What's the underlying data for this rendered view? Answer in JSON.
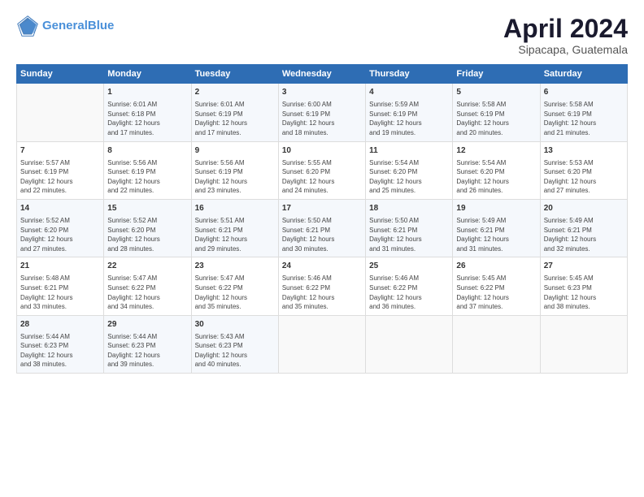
{
  "header": {
    "logo_line1": "General",
    "logo_line2": "Blue",
    "main_title": "April 2024",
    "subtitle": "Sipacapa, Guatemala"
  },
  "days_of_week": [
    "Sunday",
    "Monday",
    "Tuesday",
    "Wednesday",
    "Thursday",
    "Friday",
    "Saturday"
  ],
  "weeks": [
    [
      {
        "day": "",
        "info": ""
      },
      {
        "day": "1",
        "info": "Sunrise: 6:01 AM\nSunset: 6:18 PM\nDaylight: 12 hours\nand 17 minutes."
      },
      {
        "day": "2",
        "info": "Sunrise: 6:01 AM\nSunset: 6:19 PM\nDaylight: 12 hours\nand 17 minutes."
      },
      {
        "day": "3",
        "info": "Sunrise: 6:00 AM\nSunset: 6:19 PM\nDaylight: 12 hours\nand 18 minutes."
      },
      {
        "day": "4",
        "info": "Sunrise: 5:59 AM\nSunset: 6:19 PM\nDaylight: 12 hours\nand 19 minutes."
      },
      {
        "day": "5",
        "info": "Sunrise: 5:58 AM\nSunset: 6:19 PM\nDaylight: 12 hours\nand 20 minutes."
      },
      {
        "day": "6",
        "info": "Sunrise: 5:58 AM\nSunset: 6:19 PM\nDaylight: 12 hours\nand 21 minutes."
      }
    ],
    [
      {
        "day": "7",
        "info": "Sunrise: 5:57 AM\nSunset: 6:19 PM\nDaylight: 12 hours\nand 22 minutes."
      },
      {
        "day": "8",
        "info": "Sunrise: 5:56 AM\nSunset: 6:19 PM\nDaylight: 12 hours\nand 22 minutes."
      },
      {
        "day": "9",
        "info": "Sunrise: 5:56 AM\nSunset: 6:19 PM\nDaylight: 12 hours\nand 23 minutes."
      },
      {
        "day": "10",
        "info": "Sunrise: 5:55 AM\nSunset: 6:20 PM\nDaylight: 12 hours\nand 24 minutes."
      },
      {
        "day": "11",
        "info": "Sunrise: 5:54 AM\nSunset: 6:20 PM\nDaylight: 12 hours\nand 25 minutes."
      },
      {
        "day": "12",
        "info": "Sunrise: 5:54 AM\nSunset: 6:20 PM\nDaylight: 12 hours\nand 26 minutes."
      },
      {
        "day": "13",
        "info": "Sunrise: 5:53 AM\nSunset: 6:20 PM\nDaylight: 12 hours\nand 27 minutes."
      }
    ],
    [
      {
        "day": "14",
        "info": "Sunrise: 5:52 AM\nSunset: 6:20 PM\nDaylight: 12 hours\nand 27 minutes."
      },
      {
        "day": "15",
        "info": "Sunrise: 5:52 AM\nSunset: 6:20 PM\nDaylight: 12 hours\nand 28 minutes."
      },
      {
        "day": "16",
        "info": "Sunrise: 5:51 AM\nSunset: 6:21 PM\nDaylight: 12 hours\nand 29 minutes."
      },
      {
        "day": "17",
        "info": "Sunrise: 5:50 AM\nSunset: 6:21 PM\nDaylight: 12 hours\nand 30 minutes."
      },
      {
        "day": "18",
        "info": "Sunrise: 5:50 AM\nSunset: 6:21 PM\nDaylight: 12 hours\nand 31 minutes."
      },
      {
        "day": "19",
        "info": "Sunrise: 5:49 AM\nSunset: 6:21 PM\nDaylight: 12 hours\nand 31 minutes."
      },
      {
        "day": "20",
        "info": "Sunrise: 5:49 AM\nSunset: 6:21 PM\nDaylight: 12 hours\nand 32 minutes."
      }
    ],
    [
      {
        "day": "21",
        "info": "Sunrise: 5:48 AM\nSunset: 6:21 PM\nDaylight: 12 hours\nand 33 minutes."
      },
      {
        "day": "22",
        "info": "Sunrise: 5:47 AM\nSunset: 6:22 PM\nDaylight: 12 hours\nand 34 minutes."
      },
      {
        "day": "23",
        "info": "Sunrise: 5:47 AM\nSunset: 6:22 PM\nDaylight: 12 hours\nand 35 minutes."
      },
      {
        "day": "24",
        "info": "Sunrise: 5:46 AM\nSunset: 6:22 PM\nDaylight: 12 hours\nand 35 minutes."
      },
      {
        "day": "25",
        "info": "Sunrise: 5:46 AM\nSunset: 6:22 PM\nDaylight: 12 hours\nand 36 minutes."
      },
      {
        "day": "26",
        "info": "Sunrise: 5:45 AM\nSunset: 6:22 PM\nDaylight: 12 hours\nand 37 minutes."
      },
      {
        "day": "27",
        "info": "Sunrise: 5:45 AM\nSunset: 6:23 PM\nDaylight: 12 hours\nand 38 minutes."
      }
    ],
    [
      {
        "day": "28",
        "info": "Sunrise: 5:44 AM\nSunset: 6:23 PM\nDaylight: 12 hours\nand 38 minutes."
      },
      {
        "day": "29",
        "info": "Sunrise: 5:44 AM\nSunset: 6:23 PM\nDaylight: 12 hours\nand 39 minutes."
      },
      {
        "day": "30",
        "info": "Sunrise: 5:43 AM\nSunset: 6:23 PM\nDaylight: 12 hours\nand 40 minutes."
      },
      {
        "day": "",
        "info": ""
      },
      {
        "day": "",
        "info": ""
      },
      {
        "day": "",
        "info": ""
      },
      {
        "day": "",
        "info": ""
      }
    ]
  ]
}
